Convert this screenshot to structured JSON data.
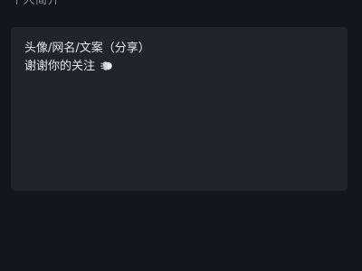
{
  "profile": {
    "section_title": "个人简介",
    "bio": {
      "line1": "头像/网名/文案（分享）",
      "line2": "谢谢你的关注",
      "line2_emoji_icon": "dash-icon"
    }
  }
}
